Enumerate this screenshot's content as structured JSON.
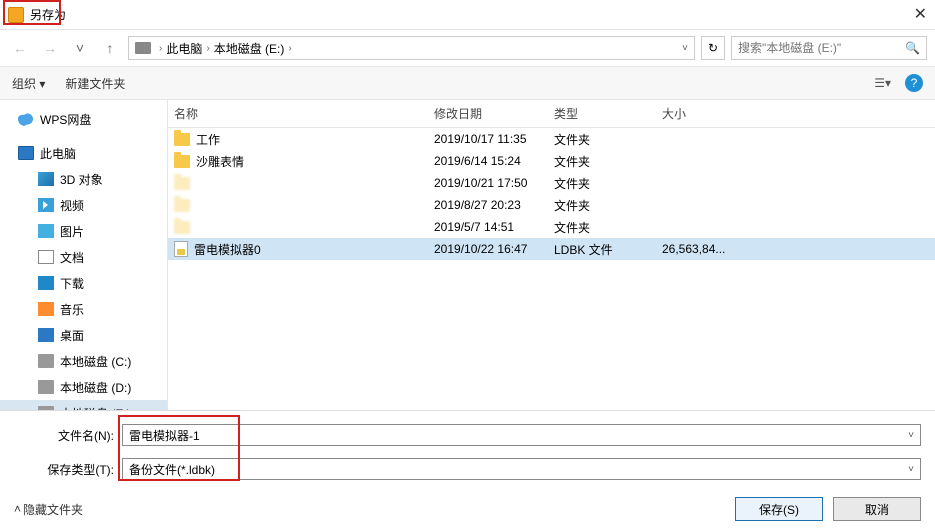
{
  "window": {
    "title": "另存为",
    "close": "✕"
  },
  "nav": {
    "back": "←",
    "forward": "→",
    "drop": "˅",
    "up": "↑",
    "crumb1": "此电脑",
    "crumb2": "本地磁盘 (E:)",
    "sep": "›",
    "refresh": "↻",
    "search_placeholder": "搜索\"本地磁盘 (E:)\"",
    "search_icon": "🔍"
  },
  "toolbar": {
    "organize": "组织",
    "newfolder": "新建文件夹",
    "view_drop": "▾",
    "help": "?"
  },
  "sidebar": {
    "items": [
      {
        "label": "WPS网盘",
        "icon": "ic-cloud",
        "child": false
      },
      {
        "label": "此电脑",
        "icon": "ic-pc",
        "child": false
      },
      {
        "label": "3D 对象",
        "icon": "ic-3d",
        "child": true
      },
      {
        "label": "视频",
        "icon": "ic-vid",
        "child": true
      },
      {
        "label": "图片",
        "icon": "ic-img",
        "child": true
      },
      {
        "label": "文档",
        "icon": "ic-doc",
        "child": true
      },
      {
        "label": "下载",
        "icon": "ic-dl",
        "child": true
      },
      {
        "label": "音乐",
        "icon": "ic-music",
        "child": true
      },
      {
        "label": "桌面",
        "icon": "ic-desk",
        "child": true
      },
      {
        "label": "本地磁盘 (C:)",
        "icon": "ic-drive",
        "child": true
      },
      {
        "label": "本地磁盘 (D:)",
        "icon": "ic-drive",
        "child": true
      },
      {
        "label": "本地磁盘 (E:)",
        "icon": "ic-drive",
        "child": true,
        "selected": true
      }
    ]
  },
  "columns": {
    "name": "名称",
    "date": "修改日期",
    "type": "类型",
    "size": "大小"
  },
  "rows": [
    {
      "name": "工作",
      "date": "2019/10/17 11:35",
      "type": "文件夹",
      "size": "",
      "icon": "folder"
    },
    {
      "name": "沙雕表情",
      "date": "2019/6/14 15:24",
      "type": "文件夹",
      "size": "",
      "icon": "folder"
    },
    {
      "name": "",
      "date": "2019/10/21 17:50",
      "type": "文件夹",
      "size": "",
      "icon": "folder-faded",
      "blur": true
    },
    {
      "name": "",
      "date": "2019/8/27 20:23",
      "type": "文件夹",
      "size": "",
      "icon": "folder-faded",
      "blur": true
    },
    {
      "name": "",
      "date": "2019/5/7 14:51",
      "type": "文件夹",
      "size": "",
      "icon": "folder-faded",
      "blur": true
    },
    {
      "name": "雷电模拟器0",
      "date": "2019/10/22 16:47",
      "type": "LDBK 文件",
      "size": "26,563,84...",
      "icon": "file",
      "selected": true
    }
  ],
  "fields": {
    "filename_label": "文件名(N):",
    "filename_value": "雷电模拟器-1",
    "type_label": "保存类型(T):",
    "type_value": "备份文件(*.ldbk)"
  },
  "footer": {
    "hide_folders": "隐藏文件夹",
    "caret": "˄",
    "save": "保存(S)",
    "cancel": "取消"
  }
}
